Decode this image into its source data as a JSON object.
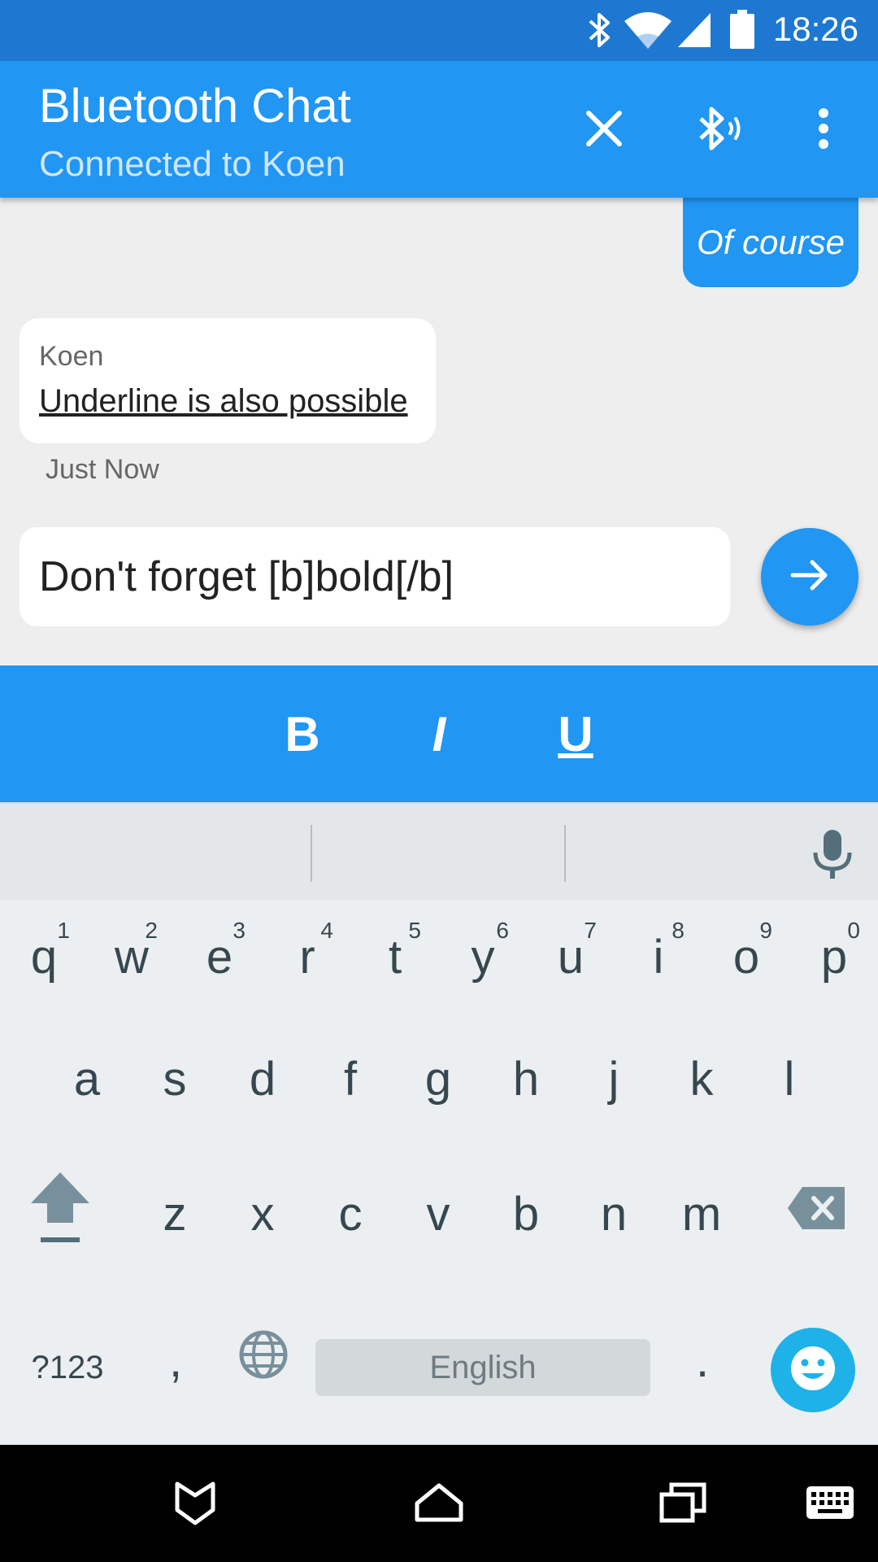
{
  "status_bar": {
    "time": "18:26",
    "icons": [
      "bluetooth-icon",
      "wifi-icon",
      "signal-icon",
      "battery-icon"
    ]
  },
  "app_bar": {
    "title": "Bluetooth Chat",
    "subtitle": "Connected to Koen",
    "actions": [
      "close-icon",
      "bluetooth-connected-icon",
      "more-vert-icon"
    ]
  },
  "chat": {
    "messages": [
      {
        "direction": "outgoing",
        "text": "Of course",
        "style": "italic"
      },
      {
        "direction": "incoming",
        "sender": "Koen",
        "text": "Underline is also possible",
        "style": "underline",
        "time": "Just Now"
      }
    ]
  },
  "composer": {
    "value": "Don't forget [b]bold[/b]",
    "send_icon": "arrow-forward-icon"
  },
  "format_bar": {
    "bold": "B",
    "italic": "I",
    "underline": "U"
  },
  "keyboard": {
    "row1": [
      {
        "key": "q",
        "num": "1"
      },
      {
        "key": "w",
        "num": "2"
      },
      {
        "key": "e",
        "num": "3"
      },
      {
        "key": "r",
        "num": "4"
      },
      {
        "key": "t",
        "num": "5"
      },
      {
        "key": "y",
        "num": "6"
      },
      {
        "key": "u",
        "num": "7"
      },
      {
        "key": "i",
        "num": "8"
      },
      {
        "key": "o",
        "num": "9"
      },
      {
        "key": "p",
        "num": "0"
      }
    ],
    "row2": [
      "a",
      "s",
      "d",
      "f",
      "g",
      "h",
      "j",
      "k",
      "l"
    ],
    "row3": [
      "z",
      "x",
      "c",
      "v",
      "b",
      "n",
      "m"
    ],
    "symbols_label": "?123",
    "comma": ",",
    "space_label": "English",
    "period": ".",
    "icons": [
      "mic-icon",
      "shift-icon",
      "backspace-icon",
      "globe-icon",
      "emoji-icon"
    ]
  },
  "nav_bar": {
    "icons": [
      "back-icon",
      "home-icon",
      "recents-icon",
      "keyboard-icon"
    ]
  },
  "colors": {
    "status_bar": "#1e78d2",
    "primary": "#2196f3",
    "keyboard_bg": "#eceff1",
    "emoji_accent": "#1fb2e8"
  }
}
